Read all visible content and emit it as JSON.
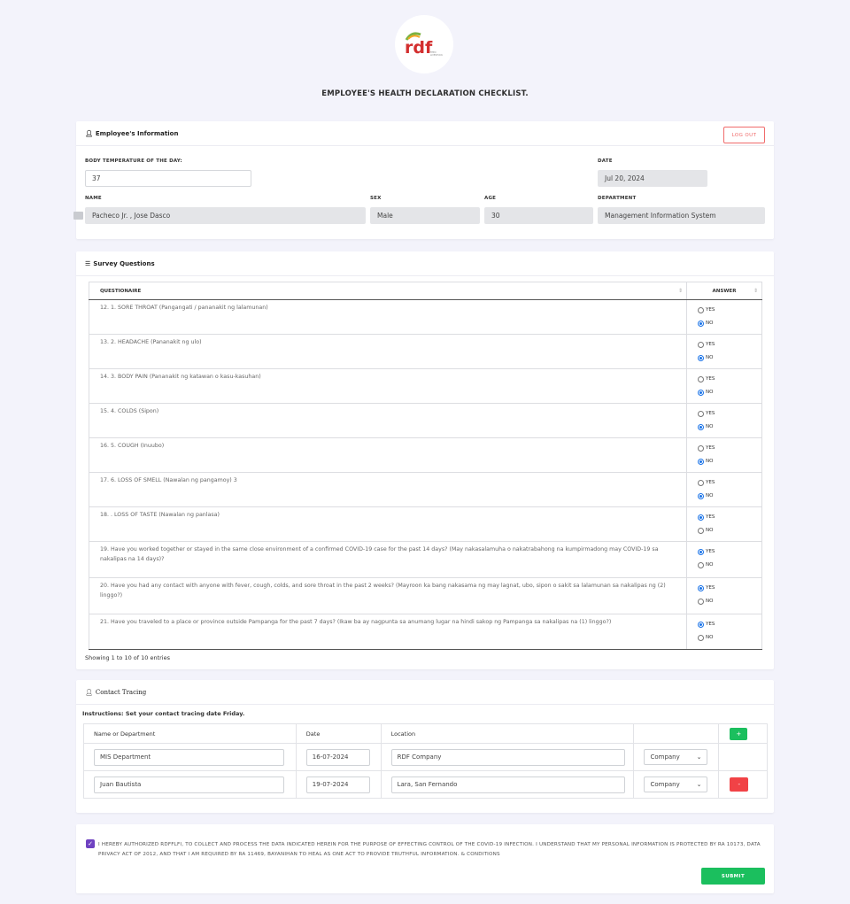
{
  "logo": {
    "brand": "rdf",
    "tagline": "FEED, LIVESTOCK & FOODS, INC."
  },
  "page_title": "EMPLOYEE'S HEALTH DECLARATION CHECKLIST.",
  "employee": {
    "header": "Employee's Information",
    "logout_label": "LOG OUT",
    "temp_label": "BODY TEMPERATURE OF THE DAY:",
    "temp_value": "37",
    "date_label": "DATE",
    "date_value": "Jul 20, 2024",
    "name_label": "NAME",
    "name_value": "Pacheco Jr. , Jose  Dasco",
    "sex_label": "SEX",
    "sex_value": "Male",
    "age_label": "AGE",
    "age_value": "30",
    "dept_label": "DEPARTMENT",
    "dept_value": "Management Information System"
  },
  "survey": {
    "header": "Survey Questions",
    "col_question": "QUESTIONAIRE",
    "col_answer": "ANSWER",
    "yes_label": "YES",
    "no_label": "NO",
    "rows": [
      {
        "q": "12. 1. SORE THROAT (Pangangati / pananakit ng lalamunan)",
        "answer": "no"
      },
      {
        "q": "13. 2. HEADACHE (Pananakit ng ulo)",
        "answer": "no"
      },
      {
        "q": "14. 3. BODY PAIN (Pananakit ng katawan o kasu-kasuhan)",
        "answer": "no"
      },
      {
        "q": "15. 4. COLDS (Sipon)",
        "answer": "no"
      },
      {
        "q": "16. 5. COUGH (Inuubo)",
        "answer": "no"
      },
      {
        "q": "17. 6. LOSS OF SMELL (Nawalan ng pangamoy) 3",
        "answer": "no"
      },
      {
        "q": "18. . LOSS OF TASTE (Nawalan ng panlasa)",
        "answer": "yes"
      },
      {
        "q": "19. Have you worked together or stayed in the same close environment of a confirmed COVID-19 case for the past 14 days? (May nakasalamuha o nakatrabahong na kumpirmadong may COVID-19 sa nakalipas na 14 days)?",
        "answer": "yes"
      },
      {
        "q": "20. Have you had any contact with anyone with fever, cough, colds, and sore throat in the past 2 weeks? (Mayroon ka bang nakasama ng may lagnat, ubo, sipon o sakit sa lalamunan sa nakalipas ng (2) linggo?)",
        "answer": "yes"
      },
      {
        "q": "21. Have you traveled to a place or province outside Pampanga for the past 7 days? (Ikaw ba ay nagpunta sa anumang lugar na hindi sakop ng Pampanga sa nakalipas na (1) linggo?)",
        "answer": "yes"
      }
    ],
    "entries_text": "Showing 1 to 10 of 10 entries"
  },
  "contact": {
    "header": "Contact Tracing",
    "instructions": "Instructions: Set your contact tracing date Friday.",
    "col_name": "Name or Department",
    "col_date": "Date",
    "col_location": "Location",
    "add_label": "+",
    "del_label": "-",
    "rows": [
      {
        "name": "MIS Department",
        "date": "16-07-2024",
        "location": "RDF Company",
        "type": "Company"
      },
      {
        "name": "Juan Bautista",
        "date": "19-07-2024",
        "location": "Lara, San Fernando",
        "type": "Company"
      }
    ]
  },
  "consent_text": "I HEREBY AUTHORIZED RDFFLFI, TO COLLECT AND PROCESS THE DATA INDICATED HEREIN FOR THE PURPOSE OF EFFECTING CONTROL OF THE COVID-19 INFECTION. I UNDERSTAND THAT MY PERSONAL INFORMATION IS PROTECTED BY RA 10173, DATA PRIVACY ACT OF 2012, AND THAT I AM REQUIRED BY RA 11469, BAYANIHAN TO HEAL AS ONE ACT TO PROVIDE TRUTHFUL INFORMATION. & CONDITIONS",
  "submit_label": "SUBMIT"
}
